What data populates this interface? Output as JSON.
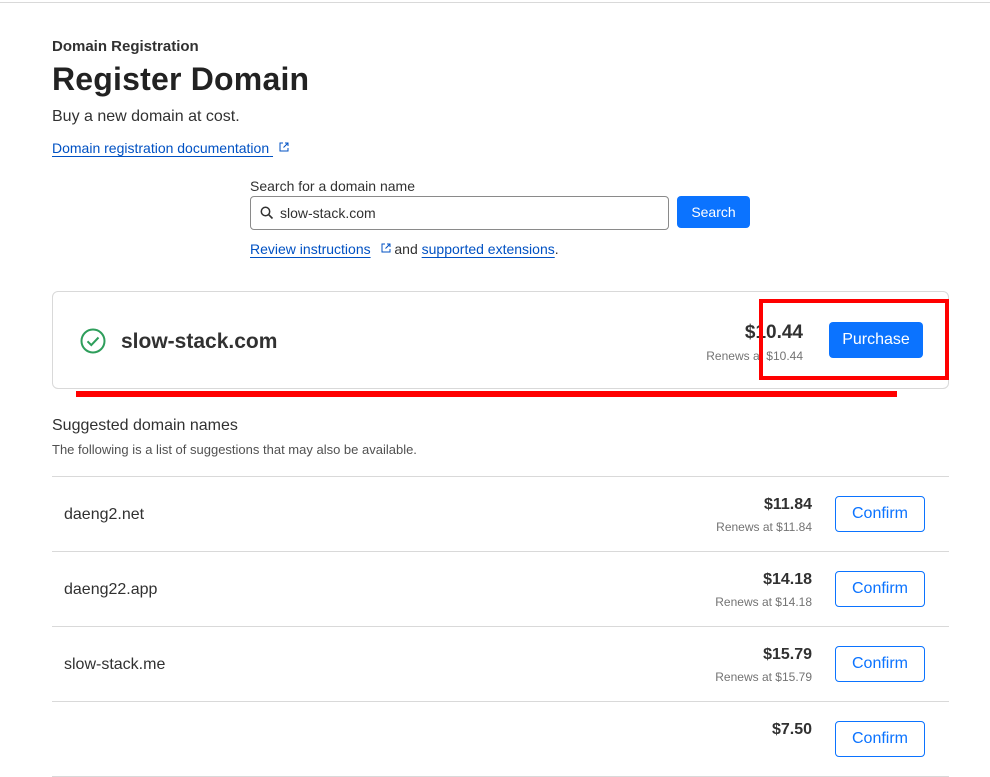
{
  "header": {
    "eyebrow": "Domain Registration",
    "title": "Register Domain",
    "subtitle": "Buy a new domain at cost.",
    "doc_link": "Domain registration documentation"
  },
  "search": {
    "label": "Search for a domain name",
    "value": "slow-stack.com",
    "button": "Search",
    "review_link": "Review instructions",
    "and_text": " and ",
    "extensions_link": "supported extensions",
    "period": "."
  },
  "result": {
    "domain": "slow-stack.com",
    "price": "$10.44",
    "renews": "Renews at $10.44",
    "button": "Purchase"
  },
  "suggestions": {
    "title": "Suggested domain names",
    "subtitle": "The following is a list of suggestions that may also be available.",
    "items": [
      {
        "name": "daeng2.net",
        "price": "$11.84",
        "renews": "Renews at $11.84",
        "button": "Confirm"
      },
      {
        "name": "daeng22.app",
        "price": "$14.18",
        "renews": "Renews at $14.18",
        "button": "Confirm"
      },
      {
        "name": "slow-stack.me",
        "price": "$15.79",
        "renews": "Renews at $15.79",
        "button": "Confirm"
      },
      {
        "name": "",
        "price": "$7.50",
        "renews": "",
        "button": "Confirm"
      }
    ]
  },
  "colors": {
    "accent": "#0b73ff",
    "link": "#0051c3",
    "success": "#2e9e5b",
    "highlight": "#ff0000"
  },
  "icons": [
    "external-link-icon",
    "search-icon",
    "check-circle-icon"
  ]
}
